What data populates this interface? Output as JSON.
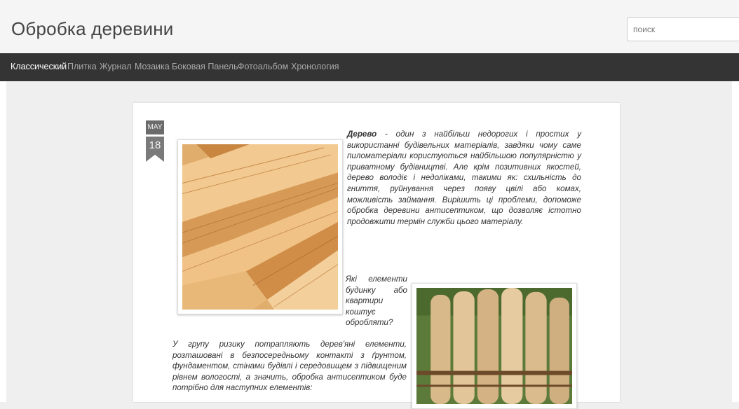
{
  "header": {
    "title": "Обробка деревини",
    "search_placeholder": "поиск"
  },
  "nav": {
    "items": [
      {
        "label": "Классический",
        "active": true
      },
      {
        "label": "Плитка"
      },
      {
        "label": "Журнал"
      },
      {
        "label": "Мозаика"
      },
      {
        "label": "Боковая Панель"
      },
      {
        "label": "Фотоальбом"
      },
      {
        "label": "Хронология"
      }
    ]
  },
  "post": {
    "date": {
      "month": "MAY",
      "day": "18"
    },
    "intro_term": "Дерево",
    "intro_text": " - один з найбільш недорогих і простих у використанні будівельних матеріалів, завдяки чому саме пиломатеріали користуються найбільшою популярністю у приватному будівництві. Але крім позитивних якостей, дерево володіє і недоліками, такими як: схильність до гниття, руйнування через появу цвілі або комах, можливість займання. Вирішить ці проблеми, допоможе обробка деревини антисептиком, що дозволяє істотно продовжити термін служби цього матеріалу.",
    "question": "Які елементи будинку або квартири коштує обробляти?",
    "risk_text": "У групу ризику потрапляють дерев'яні елементи, розташовані в безпосередньому контакті з ґрунтом, фундаментом, стінами будівлі і середовищем з підвищеним рівнем вологості, а значить, обробка антисептиком буде потрібно для наступних елементів:"
  },
  "images": [
    {
      "name": "lumber-planks-photo"
    },
    {
      "name": "round-logs-photo"
    }
  ],
  "colors": {
    "navbar": "#343434",
    "nav_text": "#aaaaaa",
    "nav_active": "#ffffff",
    "background": "#efefef",
    "date_badge": "#6b6b6b"
  }
}
